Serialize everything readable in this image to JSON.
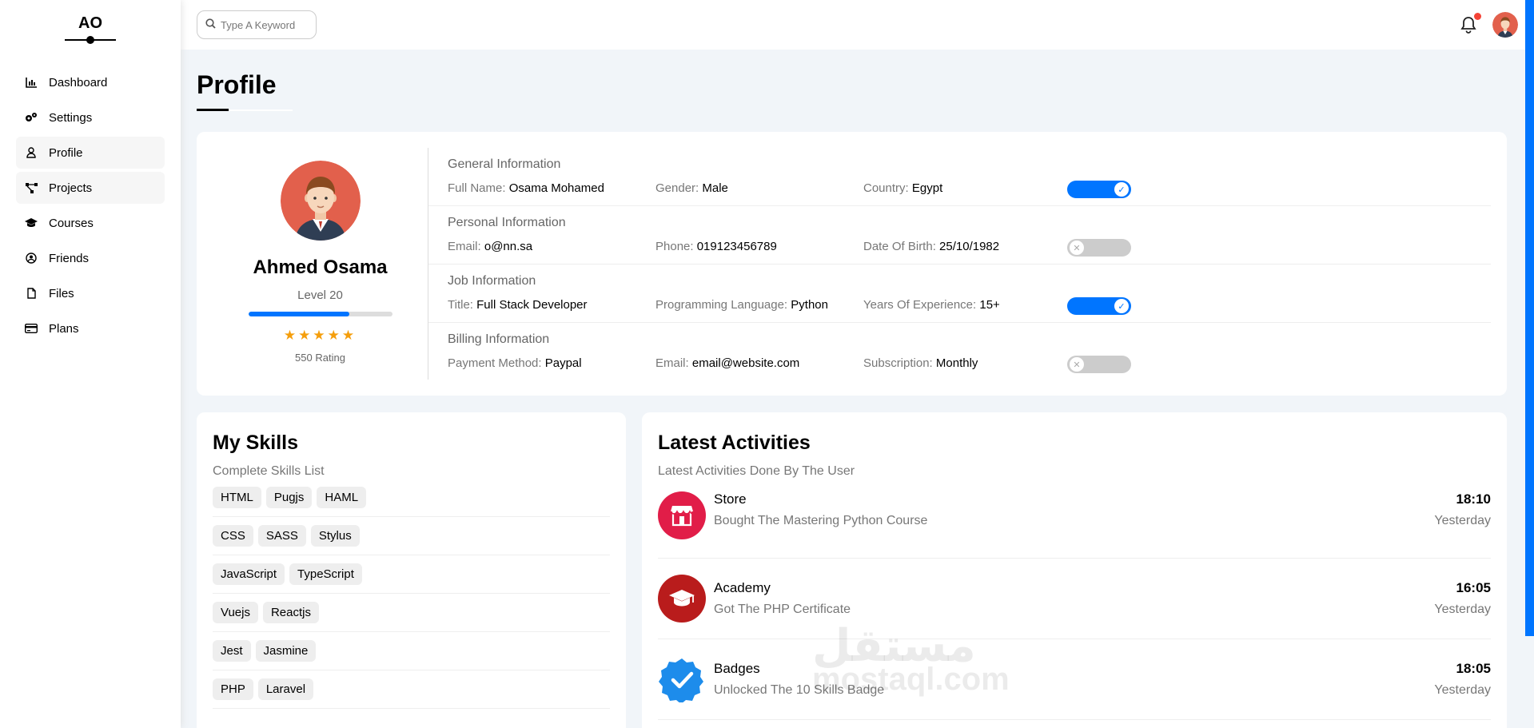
{
  "sidebar": {
    "logo": "AO",
    "items": [
      {
        "label": "Dashboard",
        "icon": "chart-icon"
      },
      {
        "label": "Settings",
        "icon": "gears-icon"
      },
      {
        "label": "Profile",
        "icon": "user-icon"
      },
      {
        "label": "Projects",
        "icon": "diagram-icon"
      },
      {
        "label": "Courses",
        "icon": "graduation-cap-icon"
      },
      {
        "label": "Friends",
        "icon": "user-circle-icon"
      },
      {
        "label": "Files",
        "icon": "file-icon"
      },
      {
        "label": "Plans",
        "icon": "credit-card-icon"
      }
    ]
  },
  "topbar": {
    "search_placeholder": "Type A Keyword"
  },
  "page": {
    "title": "Profile"
  },
  "profile": {
    "name": "Ahmed Osama",
    "level": "Level 20",
    "level_fraction": 0.7,
    "stars": 5,
    "rating": "550 Rating"
  },
  "info_sections": [
    {
      "title": "General Information",
      "fields": [
        {
          "label": "Full Name:",
          "value": "Osama Mohamed"
        },
        {
          "label": "Gender:",
          "value": "Male"
        },
        {
          "label": "Country:",
          "value": "Egypt"
        }
      ],
      "toggle": "on"
    },
    {
      "title": "Personal Information",
      "fields": [
        {
          "label": "Email:",
          "value": "o@nn.sa"
        },
        {
          "label": "Phone:",
          "value": "019123456789"
        },
        {
          "label": "Date Of Birth:",
          "value": "25/10/1982"
        }
      ],
      "toggle": "off"
    },
    {
      "title": "Job Information",
      "fields": [
        {
          "label": "Title:",
          "value": "Full Stack Developer"
        },
        {
          "label": "Programming Language:",
          "value": "Python"
        },
        {
          "label": "Years Of Experience:",
          "value": "15+"
        }
      ],
      "toggle": "on"
    },
    {
      "title": "Billing Information",
      "fields": [
        {
          "label": "Payment Method:",
          "value": "Paypal"
        },
        {
          "label": "Email:",
          "value": "email@website.com"
        },
        {
          "label": "Subscription:",
          "value": "Monthly"
        }
      ],
      "toggle": "off"
    }
  ],
  "skills": {
    "title": "My Skills",
    "subtitle": "Complete Skills List",
    "rows": [
      [
        "HTML",
        "Pugjs",
        "HAML"
      ],
      [
        "CSS",
        "SASS",
        "Stylus"
      ],
      [
        "JavaScript",
        "TypeScript"
      ],
      [
        "Vuejs",
        "Reactjs"
      ],
      [
        "Jest",
        "Jasmine"
      ],
      [
        "PHP",
        "Laravel"
      ]
    ]
  },
  "activities": {
    "title": "Latest Activities",
    "subtitle": "Latest Activities Done By The User",
    "items": [
      {
        "title": "Store",
        "desc": "Bought The Mastering Python Course",
        "time": "18:10",
        "day": "Yesterday",
        "icon": "store-icon",
        "color": "#e11d48"
      },
      {
        "title": "Academy",
        "desc": "Got The PHP Certificate",
        "time": "16:05",
        "day": "Yesterday",
        "icon": "graduation-cap-icon",
        "color": "#b91c1c"
      },
      {
        "title": "Badges",
        "desc": "Unlocked The 10 Skills Badge",
        "time": "18:05",
        "day": "Yesterday",
        "icon": "badge-check-icon",
        "color": "#1d8ceb"
      }
    ]
  },
  "watermark": {
    "arabic": "مستقل",
    "latin": "mostaql.com"
  }
}
